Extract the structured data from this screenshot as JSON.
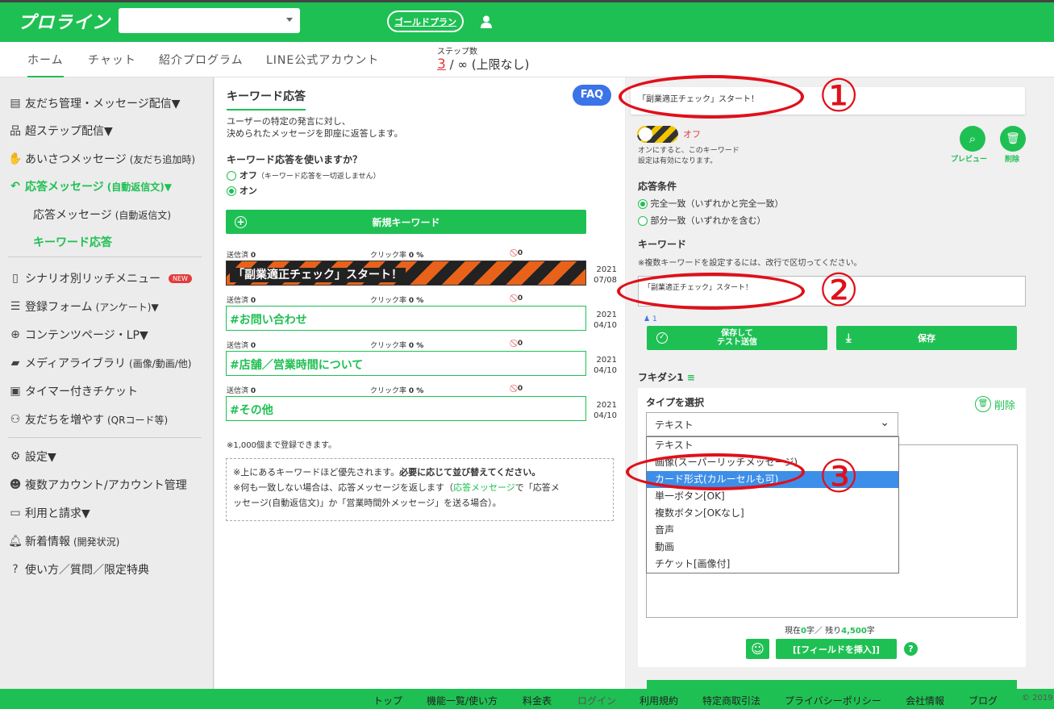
{
  "header": {
    "logo": "プロライン",
    "plan": "ゴールドプラン"
  },
  "nav": {
    "tabs": [
      "ホーム",
      "チャット",
      "紹介プログラム",
      "LINE公式アカウント"
    ],
    "steps_label": "ステップ数",
    "steps_current": "3",
    "steps_rest": "/ ∞ (上限なし)"
  },
  "sidebar": {
    "i0": "友だち管理・メッセージ配信▼",
    "i1": "超ステップ配信▼",
    "i2a": "あいさつメッセージ",
    "i2b": "(友だち追加時)",
    "i3a": "応答メッセージ",
    "i3b": "(自動返信文)▼",
    "i4a": "応答メッセージ",
    "i4b": "(自動返信文)",
    "i5": "キーワード応答",
    "i6": "シナリオ別リッチメニュー",
    "new": "NEW",
    "i7a": "登録フォーム",
    "i7b": "(アンケート)▼",
    "i8": "コンテンツページ・LP▼",
    "i9a": "メディアライブラリ",
    "i9b": "(画像/動画/他)",
    "i10": "タイマー付きチケット",
    "i11a": "友だちを増やす",
    "i11b": "(QRコード等)",
    "i12": "設定▼",
    "i13": "複数アカウント/アカウント管理",
    "i14": "利用と請求▼",
    "i15a": "新着情報",
    "i15b": "(開発状況)",
    "i16": "使い方／質問／限定特典"
  },
  "middle": {
    "title": "キーワード応答",
    "faq": "FAQ",
    "desc1": "ユーザーの特定の発言に対し、",
    "desc2": "決められたメッセージを即座に返答します。",
    "q": "キーワード応答を使いますか？",
    "off": "オフ",
    "off_note": "（キーワード応答を一切返しません）",
    "on": "オン",
    "new_kw": "新規キーワード",
    "sent": "送信済",
    "click": "クリック率",
    "zero": "0",
    "zero_pct": "0 %",
    "rows": [
      {
        "name": "「副業適正チェック」スタート！",
        "y": "2021",
        "md": "07/08"
      },
      {
        "name": "#お問い合わせ",
        "y": "2021",
        "md": "04/10"
      },
      {
        "name": "#店舗／営業時間について",
        "y": "2021",
        "md": "04/10"
      },
      {
        "name": "#その他",
        "y": "2021",
        "md": "04/10"
      }
    ],
    "limit": "※1,000個まで登録できます。",
    "note1a": "※上にあるキーワードほど優先されます。",
    "note1b": "必要に応じて並び替えてください。",
    "note2a": "※何も一致しない場合は、応答メッセージを返します（",
    "note2link": "応答メッセージ",
    "note2b": "で「応答メ",
    "note2c": "ッセージ(自動返信文)」か「営業時間外メッセージ」を送る場合）。"
  },
  "right": {
    "kw_title": "「副業適正チェック」スタート！",
    "toggle": "オフ",
    "toggle_note1": "オンにすると、このキーワード",
    "toggle_note2": "設定は有効になります。",
    "preview": "プレビュー",
    "delete": "削除",
    "cond_title": "応答条件",
    "cond1": "完全一致（いずれかと完全一致）",
    "cond2": "部分一致（いずれかを含む）",
    "kw_label": "キーワード",
    "kw_note": "※複数キーワードを設定するには、改行で区切ってください。",
    "kw_value": "「副業適正チェック」スタート！",
    "count": "1",
    "save_test1": "保存して",
    "save_test2": "テスト送信",
    "save": "保存",
    "bubble": "フキダシ1",
    "type_label": "タイプを選択",
    "del2": "削除",
    "type_value": "テキスト",
    "options": [
      "テキスト",
      "画像(スーパーリッチメッセージ)",
      "カード形式(カルーセルも可)",
      "単一ボタン[OK]",
      "複数ボタン[OKなし]",
      "音声",
      "動画",
      "チケット[画像付]"
    ],
    "charcount_a": "現在",
    "charcount_b": "0",
    "charcount_c": "字／ 残り",
    "charcount_d": "4,500",
    "charcount_e": "字",
    "insert": "[[フィールドを挿入]]",
    "help": "?"
  },
  "annotations": {
    "n1": "①",
    "n2": "②",
    "n3": "③"
  },
  "footer": {
    "links": [
      "トップ",
      "機能一覧/使い方",
      "料金表",
      "ログイン",
      "利用規約",
      "特定商取引法",
      "プライバシーポリシー",
      "会社情報",
      "ブログ"
    ],
    "copy": "© 2019"
  }
}
